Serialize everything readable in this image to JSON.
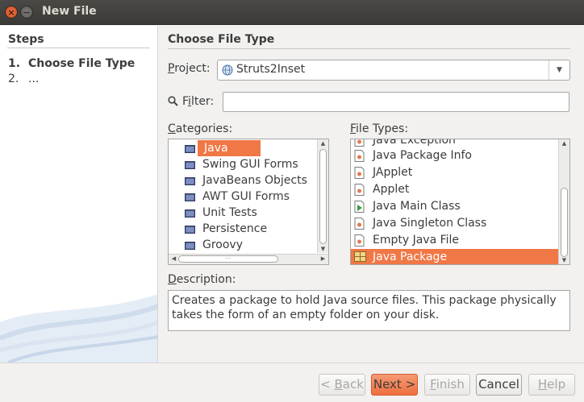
{
  "window": {
    "title": "New File",
    "close_symbol": "×",
    "minimize_symbol": "−"
  },
  "steps": {
    "title": "Steps",
    "items": [
      {
        "num": "1.",
        "label": "Choose File Type"
      },
      {
        "num": "2.",
        "label": "..."
      }
    ]
  },
  "main": {
    "title": "Choose File Type",
    "project_label_u": "P",
    "project_label_rest": "roject:",
    "project_value": "Struts2Inset",
    "filter_label_u": "i",
    "filter_label_pre": "F",
    "filter_label_rest": "lter:",
    "filter_value": "",
    "categories_label_u": "C",
    "categories_label_rest": "ategories:",
    "file_types_label_u": "F",
    "file_types_label_rest": "ile Types:",
    "description_label_u": "D",
    "description_label_rest": "escription:",
    "description_text": "Creates a package to hold Java source files. This package physically takes the form of an empty folder on your disk."
  },
  "categories": [
    {
      "label": "Java",
      "selected": true
    },
    {
      "label": "Swing GUI Forms"
    },
    {
      "label": "JavaBeans Objects"
    },
    {
      "label": "AWT GUI Forms"
    },
    {
      "label": "Unit Tests"
    },
    {
      "label": "Persistence"
    },
    {
      "label": "Groovy"
    }
  ],
  "file_types": [
    {
      "label": "Java Exception",
      "icon": "java-file-icon"
    },
    {
      "label": "Java Package Info",
      "icon": "java-file-icon"
    },
    {
      "label": "JApplet",
      "icon": "java-file-icon"
    },
    {
      "label": "Applet",
      "icon": "java-file-icon"
    },
    {
      "label": "Java Main Class",
      "icon": "java-main-class-icon"
    },
    {
      "label": "Java Singleton Class",
      "icon": "java-file-icon"
    },
    {
      "label": "Empty Java File",
      "icon": "java-file-icon"
    },
    {
      "label": "Java Package",
      "icon": "package-icon",
      "selected": true
    }
  ],
  "buttons": {
    "back_pre": "< ",
    "back_u": "B",
    "back_rest": "ack",
    "next": "Next >",
    "finish_u": "F",
    "finish_rest": "inish",
    "cancel": "Cancel",
    "help_u": "H",
    "help_rest": "elp"
  },
  "colors": {
    "accent": "#f07746",
    "titlebar": "#3c3b37"
  }
}
